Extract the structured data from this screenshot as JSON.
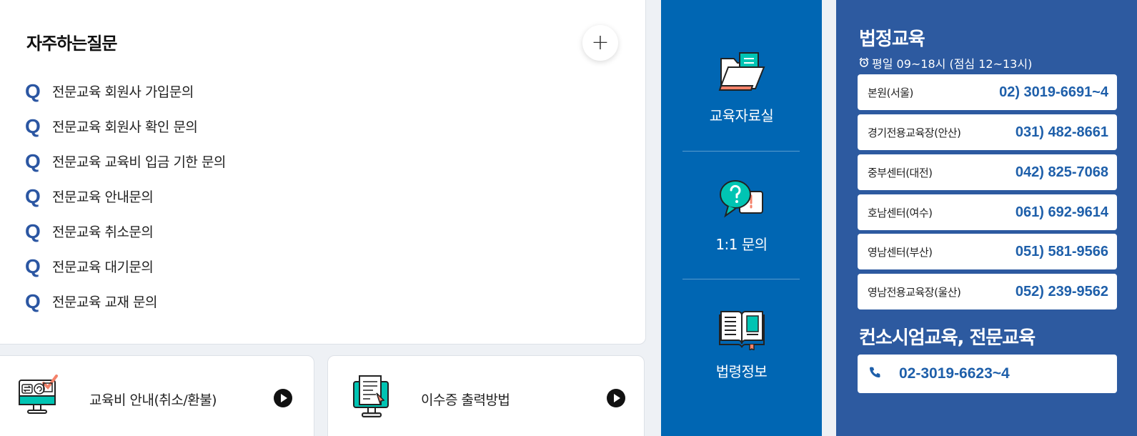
{
  "faq": {
    "title": "자주하는질문",
    "more_label": "+",
    "q_marker": "Q",
    "items": [
      "전문교육 회원사 가입문의",
      "전문교육 회원사 확인 문의",
      "전문교육 교육비 입금 기한 문의",
      "전문교육 안내문의",
      "전문교육 취소문의",
      "전문교육 대기문의",
      "전문교육 교재 문의"
    ]
  },
  "bottom_cards": [
    {
      "label": "교육비 안내(취소/환불)",
      "icon": "refund-monitor-icon"
    },
    {
      "label": "이수증 출력방법",
      "icon": "certificate-monitor-icon"
    }
  ],
  "quick_links": [
    {
      "label": "교육자료실",
      "icon": "folder-document-icon"
    },
    {
      "label": "1:1 문의",
      "icon": "speech-bubble-question-icon"
    },
    {
      "label": "법령정보",
      "icon": "open-book-icon"
    }
  ],
  "contact": {
    "title": "법정교육",
    "hours": "평일 09~18시 (점심 12~13시)",
    "offices": [
      {
        "name": "본원(서울)",
        "phone": "02) 3019-6691~4"
      },
      {
        "name": "경기전용교육장(안산)",
        "phone": "031) 482-8661"
      },
      {
        "name": "중부센터(대전)",
        "phone": "042) 825-7068"
      },
      {
        "name": "호남센터(여수)",
        "phone": "061) 692-9614"
      },
      {
        "name": "영남센터(부산)",
        "phone": "051) 581-9566"
      },
      {
        "name": "영남전용교육장(울산)",
        "phone": "052) 239-9562"
      }
    ],
    "sub_title": "컨소시엄교육, 전문교육",
    "sub_phone": "02-3019-6623~4"
  },
  "colors": {
    "accent_blue": "#0066b3",
    "panel_blue": "#2d5aa0",
    "phone_text": "#1e5faa",
    "q_marker": "#2b56a2",
    "icon_teal": "#00c4b3",
    "icon_salmon": "#f4826a"
  }
}
